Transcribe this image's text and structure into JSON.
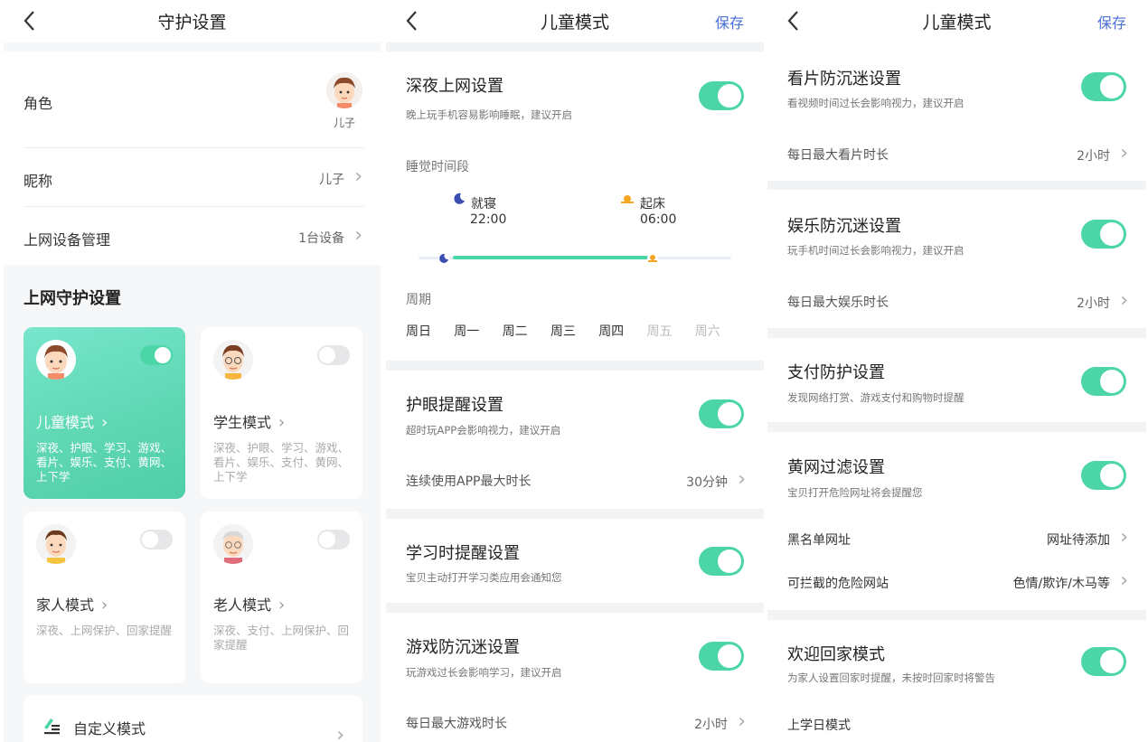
{
  "colors": {
    "accent": "#4cd6a8",
    "save": "#4a6fd6"
  },
  "panel1": {
    "title": "守护设置",
    "role_label": "角色",
    "role_value": "儿子",
    "nickname_label": "昵称",
    "nickname_value": "儿子",
    "device_label": "上网设备管理",
    "device_value": "1台设备",
    "section_title": "上网守护设置",
    "modes": [
      {
        "name": "儿童模式",
        "desc": "深夜、护眼、学习、游戏、看片、娱乐、支付、黄网、上下学",
        "enabled": true
      },
      {
        "name": "学生模式",
        "desc": "深夜、护眼、学习、游戏、看片、娱乐、支付、黄网、上下学",
        "enabled": false
      },
      {
        "name": "家人模式",
        "desc": "深夜、上网保护、回家提醒",
        "enabled": false
      },
      {
        "name": "老人模式",
        "desc": "深夜、支付、上网保护、回家提醒",
        "enabled": false
      }
    ],
    "custom_label": "自定义模式"
  },
  "panel2": {
    "title": "儿童模式",
    "save": "保存",
    "night": {
      "title": "深夜上网设置",
      "desc": "晚上玩手机容易影响睡眠，建议开启",
      "enabled": true
    },
    "sleep_label": "睡觉时间段",
    "bedtime_label": "就寝",
    "bedtime_value": "22:00",
    "wake_label": "起床",
    "wake_value": "06:00",
    "week_label": "周期",
    "weekdays": [
      {
        "label": "周日",
        "on": true
      },
      {
        "label": "周一",
        "on": true
      },
      {
        "label": "周二",
        "on": true
      },
      {
        "label": "周三",
        "on": true
      },
      {
        "label": "周四",
        "on": true
      },
      {
        "label": "周五",
        "on": false
      },
      {
        "label": "周六",
        "on": false
      }
    ],
    "eye": {
      "title": "护眼提醒设置",
      "desc": "超时玩APP会影响视力，建议开启",
      "enabled": true,
      "row_label": "连续使用APP最大时长",
      "row_value": "30分钟"
    },
    "study": {
      "title": "学习时提醒设置",
      "desc": "宝贝主动打开学习类应用会通知您",
      "enabled": true
    },
    "game": {
      "title": "游戏防沉迷设置",
      "desc": "玩游戏过长会影响学习，建议开启",
      "enabled": true,
      "row_label": "每日最大游戏时长",
      "row_value": "2小时"
    }
  },
  "panel3": {
    "title": "儿童模式",
    "save": "保存",
    "video": {
      "title": "看片防沉迷设置",
      "desc": "看视频时间过长会影响视力，建议开启",
      "enabled": true,
      "row_label": "每日最大看片时长",
      "row_value": "2小时"
    },
    "fun": {
      "title": "娱乐防沉迷设置",
      "desc": "玩手机时间过长会影响视力，建议开启",
      "enabled": true,
      "row_label": "每日最大娱乐时长",
      "row_value": "2小时"
    },
    "pay": {
      "title": "支付防护设置",
      "desc": "发现网络打赏、游戏支付和购物时提醒",
      "enabled": true
    },
    "filter": {
      "title": "黄网过滤设置",
      "desc": "宝贝打开危险网址将会提醒您",
      "enabled": true,
      "blacklist_label": "黑名单网址",
      "blacklist_value": "网址待添加",
      "danger_label": "可拦截的危险网站",
      "danger_value": "色情/欺诈/木马等"
    },
    "home": {
      "title": "欢迎回家模式",
      "desc": "为家人设置回家时提醒，未按时回家时将警告",
      "enabled": true
    },
    "school_label": "上学日模式"
  }
}
